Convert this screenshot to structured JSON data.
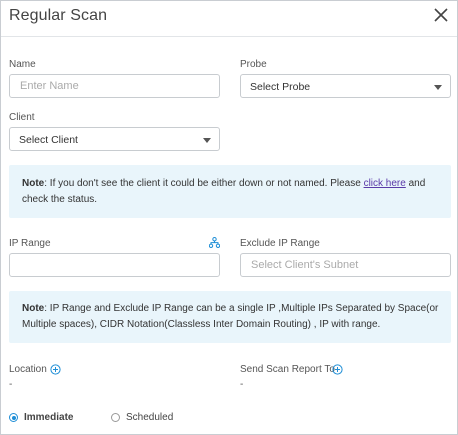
{
  "dialog": {
    "title": "Regular Scan"
  },
  "name": {
    "label": "Name",
    "placeholder": "Enter Name"
  },
  "probe": {
    "label": "Probe",
    "value": "Select Probe"
  },
  "client": {
    "label": "Client",
    "value": "Select Client"
  },
  "note1": {
    "prefix": "Note",
    "text": ": If you don't see the client it could be either down or not named. Please ",
    "link": "click here",
    "suffix": " and check the status."
  },
  "ip_range": {
    "label": "IP Range",
    "value": ""
  },
  "exclude_ip": {
    "label": "Exclude IP Range",
    "placeholder": "Select Client's Subnet"
  },
  "note2": {
    "prefix": "Note",
    "text": ": IP Range and Exclude IP Range can be a single IP ,Multiple IPs Separated by Space(or Multiple spaces), CIDR Notation(Classless Inter Domain Routing) , IP with range."
  },
  "location": {
    "label": "Location",
    "value": "-"
  },
  "report": {
    "label": "Send Scan Report To",
    "value": "-"
  },
  "schedule": {
    "immediate": "Immediate",
    "scheduled": "Scheduled",
    "selected": "Immediate"
  },
  "colors": {
    "accent": "#1f8ed6",
    "note_bg": "#e9f5fb",
    "link": "#5a3aa8"
  }
}
